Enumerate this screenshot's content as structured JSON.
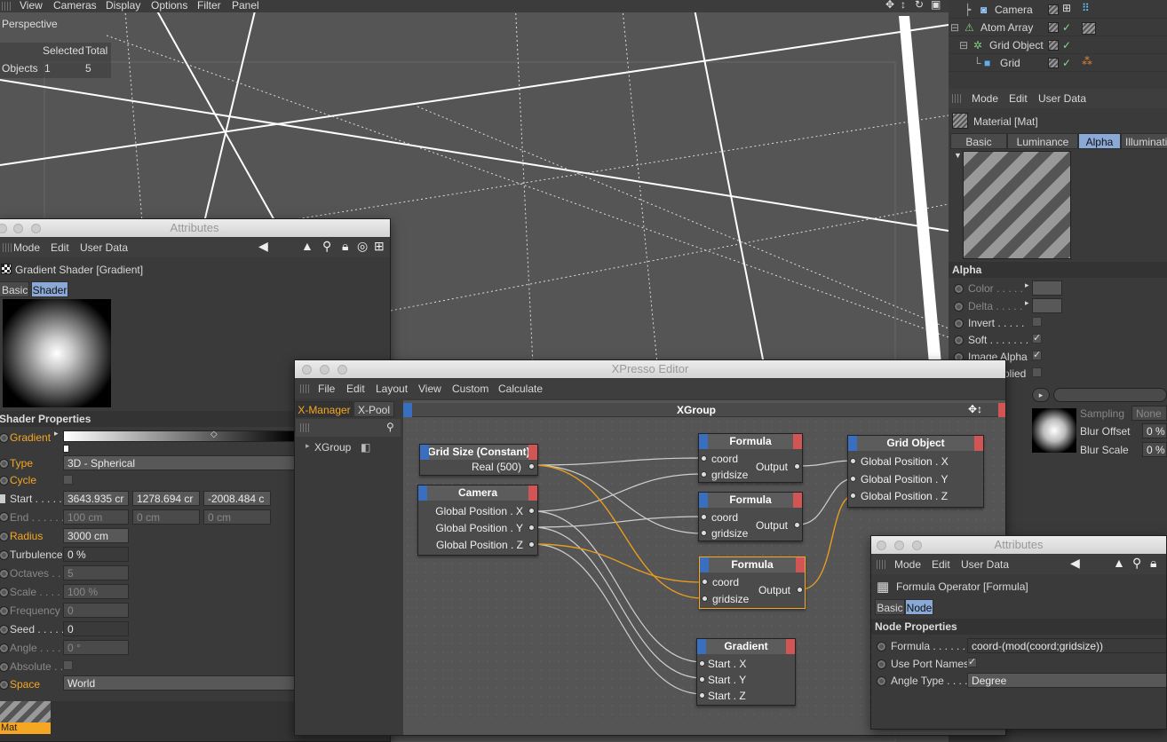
{
  "viewport": {
    "menu": [
      "View",
      "Cameras",
      "Display",
      "Options",
      "Filter",
      "Panel"
    ],
    "label": "Perspective",
    "hud": {
      "col1": "Selected",
      "col2": "Total",
      "row_label": "Objects",
      "selected": "1",
      "total": "5"
    }
  },
  "objects": [
    {
      "name": "Camera"
    },
    {
      "name": "Atom Array"
    },
    {
      "name": "Grid Object"
    },
    {
      "name": "Grid"
    }
  ],
  "mat_attr": {
    "menu": [
      "Mode",
      "Edit",
      "User Data"
    ],
    "title": "Material [Mat]",
    "tabs": [
      "Basic",
      "Luminance",
      "Alpha",
      "Illuminatio"
    ],
    "active_tab": "Alpha",
    "section": "Alpha",
    "rows": [
      {
        "label": "Color . . . . ."
      },
      {
        "label": "Delta . . . . ."
      },
      {
        "label": "Invert . . . . ."
      },
      {
        "label": "Soft . . . . . . . ."
      },
      {
        "label": "Image Alpha"
      },
      {
        "label": "plied"
      }
    ],
    "sampling_label": "Sampling",
    "sampling_value": "None",
    "blur_offset_label": "Blur Offset",
    "blur_offset_value": "0 %",
    "blur_scale_label": "Blur Scale",
    "blur_scale_value": "0 %"
  },
  "attr_left": {
    "title": "Attributes",
    "menu": [
      "Mode",
      "Edit",
      "User Data"
    ],
    "object": "Gradient Shader [Gradient]",
    "tabs": [
      "Basic",
      "Shader"
    ],
    "active_tab": "Shader",
    "section": "Shader Properties",
    "gradient_label": "Gradient",
    "type_label": "Type",
    "type_value": "3D - Spherical",
    "cycle_label": "Cycle",
    "start_label": "Start . . . . .",
    "start_x": "3643.935 cr",
    "start_y": "1278.694 cr",
    "start_z": "-2008.484 c",
    "end_label": "End . . . . . .",
    "end_x": "100 cm",
    "end_y": "0 cm",
    "end_z": "0 cm",
    "radius_label": "Radius",
    "radius_value": "3000 cm",
    "turbulence_label": "Turbulence",
    "turbulence_value": "0 %",
    "octaves_label": "Octaves . .",
    "octaves_value": "5",
    "scale_label": "Scale . . . . .",
    "scale_value": "100 %",
    "frequency_label": "Frequency",
    "frequency_value": "0",
    "seed_label": "Seed . . . . .",
    "seed_value": "0",
    "angle_label": "Angle . . . .",
    "angle_value": "0 °",
    "absolute_label": "Absolute . .",
    "space_label": "Space",
    "space_value": "World",
    "mat_label": "Mat"
  },
  "xpresso": {
    "title": "XPresso Editor",
    "menu": [
      "File",
      "Edit",
      "Layout",
      "View",
      "Custom",
      "Calculate"
    ],
    "tabs": [
      "X-Manager",
      "X-Pool"
    ],
    "tree_item": "XGroup",
    "group_title": "XGroup",
    "nodes": {
      "gridsize": {
        "title": "Grid Size (Constant)",
        "out": "Real (500)"
      },
      "camera": {
        "title": "Camera",
        "outs": [
          "Global Position . X",
          "Global Position . Y",
          "Global Position . Z"
        ]
      },
      "formula1": {
        "title": "Formula",
        "ins": [
          "coord",
          "gridsize"
        ],
        "out": "Output"
      },
      "formula2": {
        "title": "Formula",
        "ins": [
          "coord",
          "gridsize"
        ],
        "out": "Output"
      },
      "formula3": {
        "title": "Formula",
        "ins": [
          "coord",
          "gridsize"
        ],
        "out": "Output"
      },
      "gridobj": {
        "title": "Grid Object",
        "ins": [
          "Global Position . X",
          "Global Position . Y",
          "Global Position . Z"
        ]
      },
      "gradient": {
        "title": "Gradient",
        "ins": [
          "Start . X",
          "Start . Y",
          "Start . Z"
        ]
      }
    }
  },
  "attr_right": {
    "title": "Attributes",
    "menu": [
      "Mode",
      "Edit",
      "User Data"
    ],
    "object": "Formula Operator [Formula]",
    "tabs": [
      "Basic",
      "Node"
    ],
    "active_tab": "Node",
    "section": "Node Properties",
    "formula_label": "Formula . . . . . . . . .",
    "formula_value": "coord-(mod(coord;gridsize))",
    "use_port_label": "Use Port Names",
    "angle_label": "Angle Type . . . .",
    "angle_value": "Degree"
  },
  "colors": {
    "accent": "#f5a623",
    "tab_active": "#8aa9d6",
    "node_in": "#3a6fbf",
    "node_out": "#d25555"
  }
}
